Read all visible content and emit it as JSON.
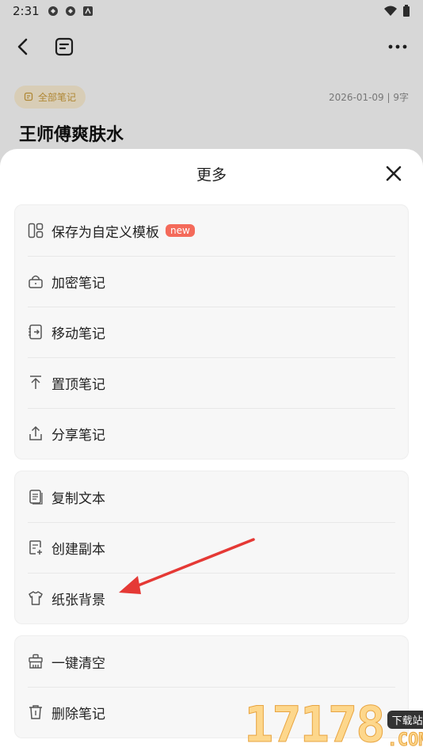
{
  "status_bar": {
    "time": "2:31"
  },
  "header": {
    "back_icon": "chevron-left-icon",
    "doc_icon": "note-icon",
    "more_icon": "more-horizontal-icon"
  },
  "note": {
    "folder": "全部笔记",
    "meta": "2026-01-09 | 9字",
    "title": "王师傅爽肤水"
  },
  "sheet": {
    "title": "更多",
    "groups": [
      {
        "items": [
          {
            "label": "保存为自定义模板",
            "icon": "template-icon",
            "badge": "new"
          },
          {
            "label": "加密笔记",
            "icon": "lock-icon"
          },
          {
            "label": "移动笔记",
            "icon": "move-icon"
          },
          {
            "label": "置顶笔记",
            "icon": "pin-top-icon"
          },
          {
            "label": "分享笔记",
            "icon": "share-icon"
          }
        ]
      },
      {
        "items": [
          {
            "label": "复制文本",
            "icon": "copy-text-icon"
          },
          {
            "label": "创建副本",
            "icon": "duplicate-icon"
          },
          {
            "label": "纸张背景",
            "icon": "shirt-icon"
          }
        ]
      },
      {
        "items": [
          {
            "label": "一键清空",
            "icon": "clear-icon"
          },
          {
            "label": "删除笔记",
            "icon": "trash-icon"
          }
        ]
      }
    ]
  },
  "annotation": {
    "arrow_color": "#e53935"
  },
  "watermark": {
    "number": "17178",
    "tag": "下载站",
    "suffix": ".COM"
  }
}
